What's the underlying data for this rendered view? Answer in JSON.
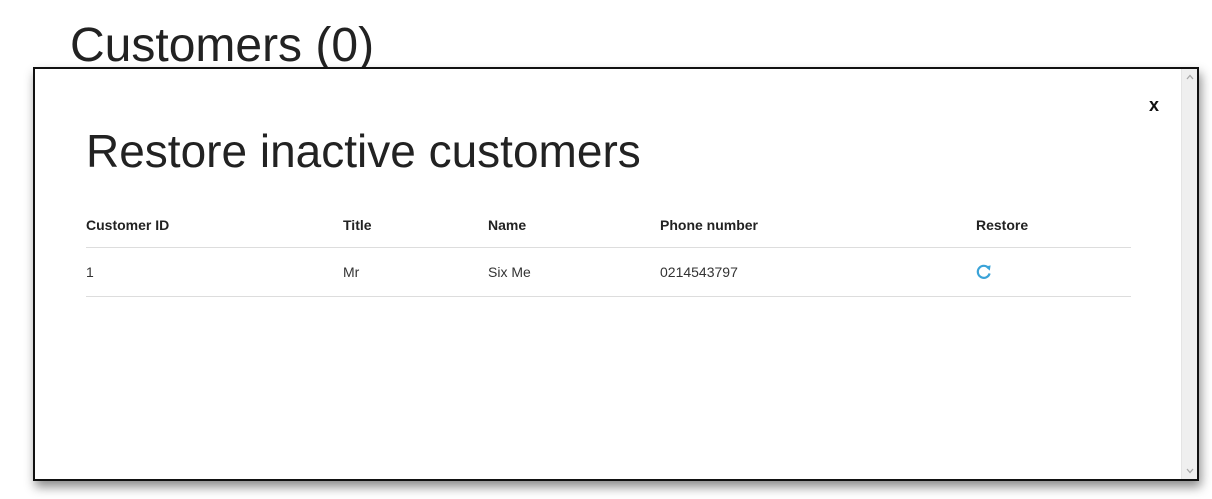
{
  "page": {
    "title": "Customers (0)"
  },
  "modal": {
    "close_label": "x",
    "heading": "Restore inactive customers",
    "table": {
      "headers": {
        "customer_id": "Customer ID",
        "title": "Title",
        "name": "Name",
        "phone": "Phone number",
        "restore": "Restore"
      },
      "rows": [
        {
          "customer_id": "1",
          "title": "Mr",
          "name": "Six Me",
          "phone": "0214543797",
          "restore_icon": "refresh-icon"
        }
      ]
    }
  },
  "colors": {
    "accent": "#3aa3d8",
    "text": "#222222",
    "border": "#dddddd"
  },
  "icons": {
    "restore": "refresh-icon",
    "scroll_up": "chevron-up-icon",
    "scroll_down": "chevron-down-icon"
  }
}
